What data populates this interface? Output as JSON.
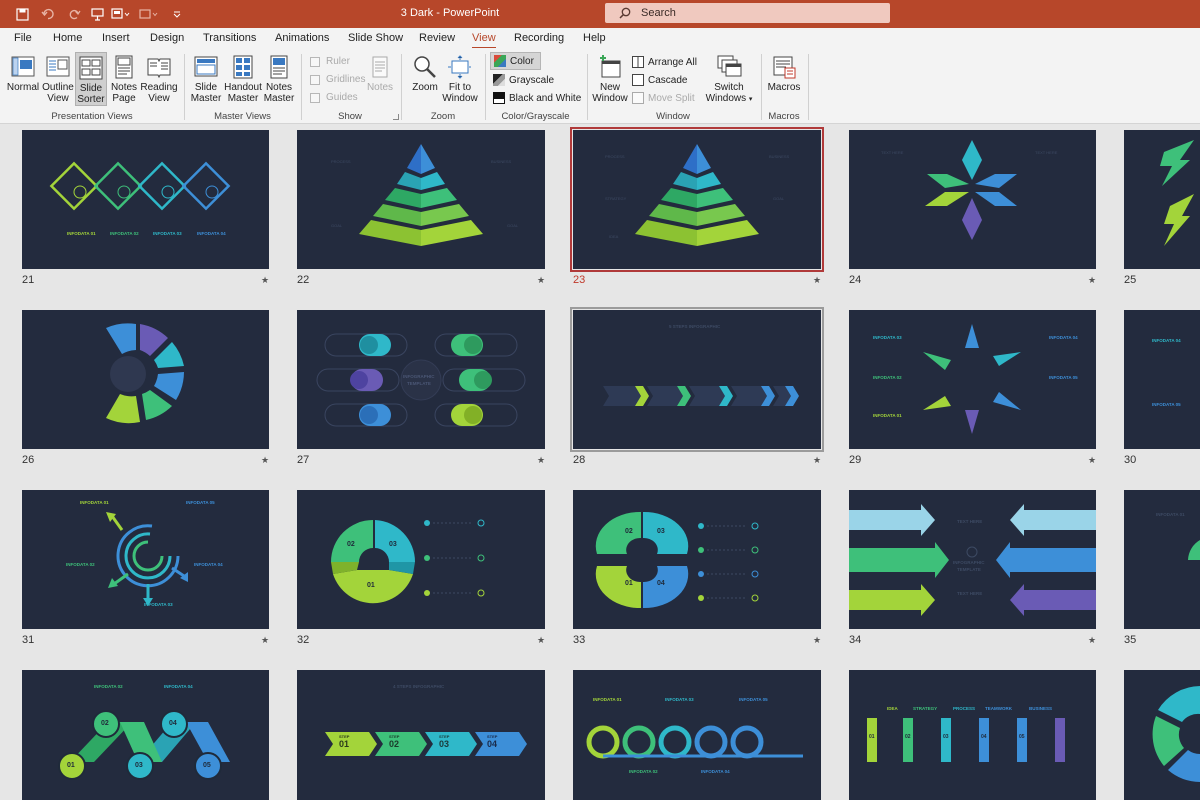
{
  "window": {
    "title": "3 Dark  -  PowerPoint"
  },
  "search": {
    "placeholder": "Search"
  },
  "tabs": [
    "File",
    "Home",
    "Insert",
    "Design",
    "Transitions",
    "Animations",
    "Slide Show",
    "Review",
    "View",
    "Recording",
    "Help"
  ],
  "active_tab": "View",
  "ribbon": {
    "presentation_views": {
      "label": "Presentation Views",
      "normal": "Normal",
      "outline": "Outline View",
      "sorter": "Slide Sorter",
      "notes_page": "Notes Page",
      "reading": "Reading View"
    },
    "master_views": {
      "label": "Master Views",
      "slide": "Slide Master",
      "handout": "Handout Master",
      "notes": "Notes Master"
    },
    "show": {
      "label": "Show",
      "ruler": "Ruler",
      "gridlines": "Gridlines",
      "guides": "Guides",
      "notes": "Notes"
    },
    "zoom": {
      "label": "Zoom",
      "zoom": "Zoom",
      "fit": "Fit to Window"
    },
    "color": {
      "label": "Color/Grayscale",
      "color": "Color",
      "grayscale": "Grayscale",
      "bw": "Black and White"
    },
    "window": {
      "label": "Window",
      "new": "New Window",
      "arrange": "Arrange All",
      "cascade": "Cascade",
      "split": "Move Split",
      "switch": "Switch Windows"
    },
    "macros": {
      "label": "Macros",
      "macros": "Macros"
    }
  },
  "slides": {
    "n21": "21",
    "n22": "22",
    "n23": "23",
    "n24": "24",
    "n25": "25",
    "n26": "26",
    "n27": "27",
    "n28": "28",
    "n29": "29",
    "n30": "30",
    "n31": "31",
    "n32": "32",
    "n33": "33",
    "n34": "34",
    "n35": "35",
    "star": "★",
    "infodata01": "INFODATA 01",
    "infodata02": "INFODATA 02",
    "infodata03": "INFODATA 03",
    "infodata04": "INFODATA 04",
    "infodata05": "INFODATA 05",
    "process": "PROCESS",
    "business": "BUSINESS",
    "strategy": "STRATEGY",
    "goal": "GOAL",
    "idea": "IDEA",
    "teamwork": "TEAMWORK",
    "infographic": "INFOGRAPHIC",
    "template": "TEMPLATE",
    "five_steps": "5 STEPS INFOGRAPHIC",
    "four_steps": "4 STEPS INFOGRAPHIC",
    "text_here": "TEXT HERE",
    "step": "STEP",
    "d01": "01",
    "d02": "02",
    "d03": "03",
    "d04": "04",
    "d05": "05"
  },
  "colors": {
    "titlebar": "#b7472a",
    "slide_bg": "#232b3e",
    "lime": "#a3d43a",
    "green": "#3ec07a",
    "teal": "#2fb8c9",
    "blue": "#3d8fd8",
    "purple": "#6a5bb5",
    "selected_outline": "#b03a3a"
  }
}
